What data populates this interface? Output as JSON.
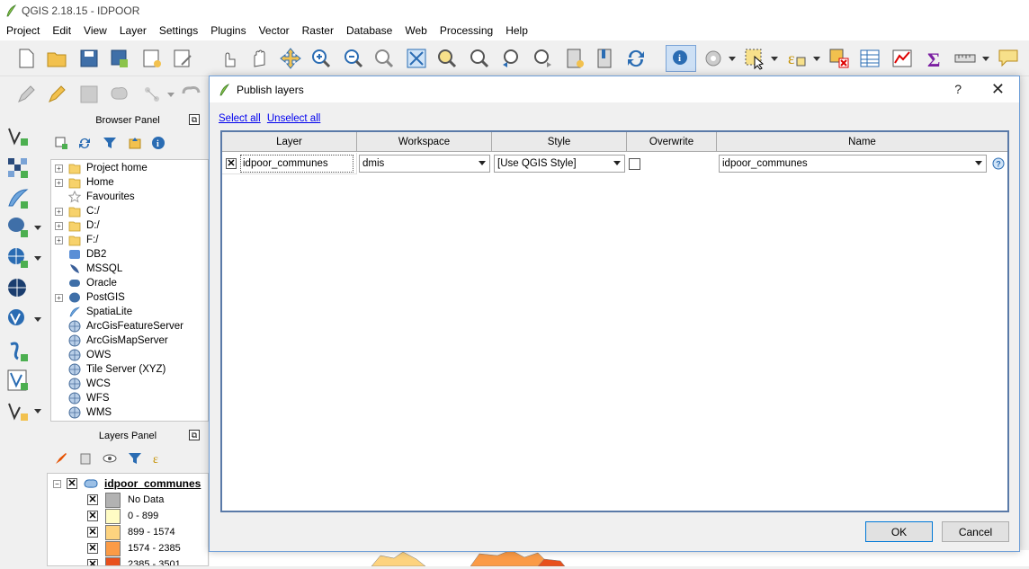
{
  "window": {
    "title": "QGIS 2.18.15 - IDPOOR"
  },
  "menu": [
    "Project",
    "Edit",
    "View",
    "Layer",
    "Settings",
    "Plugins",
    "Vector",
    "Raster",
    "Database",
    "Web",
    "Processing",
    "Help"
  ],
  "browser_panel": {
    "title": "Browser Panel",
    "items": [
      {
        "label": "Project home",
        "icon": "folder-icon",
        "expandable": true
      },
      {
        "label": "Home",
        "icon": "folder-icon",
        "expandable": true
      },
      {
        "label": "Favourites",
        "icon": "star-icon",
        "expandable": false
      },
      {
        "label": "C:/",
        "icon": "folder-icon",
        "expandable": true
      },
      {
        "label": "D:/",
        "icon": "folder-icon",
        "expandable": true
      },
      {
        "label": "F:/",
        "icon": "folder-icon",
        "expandable": true
      },
      {
        "label": "DB2",
        "icon": "db2-icon",
        "expandable": false
      },
      {
        "label": "MSSQL",
        "icon": "mssql-icon",
        "expandable": false
      },
      {
        "label": "Oracle",
        "icon": "oracle-icon",
        "expandable": false
      },
      {
        "label": "PostGIS",
        "icon": "postgis-icon",
        "expandable": true
      },
      {
        "label": "SpatiaLite",
        "icon": "spatialite-icon",
        "expandable": false
      },
      {
        "label": "ArcGisFeatureServer",
        "icon": "globe-icon",
        "expandable": false
      },
      {
        "label": "ArcGisMapServer",
        "icon": "globe-icon",
        "expandable": false
      },
      {
        "label": "OWS",
        "icon": "globe-icon",
        "expandable": false
      },
      {
        "label": "Tile Server (XYZ)",
        "icon": "globe-icon",
        "expandable": false
      },
      {
        "label": "WCS",
        "icon": "globe-icon",
        "expandable": false
      },
      {
        "label": "WFS",
        "icon": "globe-icon",
        "expandable": false
      },
      {
        "label": "WMS",
        "icon": "globe-icon",
        "expandable": false
      }
    ]
  },
  "layers_panel": {
    "title": "Layers Panel",
    "layer_name": "idpoor_communes",
    "legend": [
      {
        "label": "No Data",
        "color": "#b2b2b2"
      },
      {
        "label": "0 - 899",
        "color": "#fffcc4"
      },
      {
        "label": "899 - 1574",
        "color": "#fdd37f"
      },
      {
        "label": "1574 - 2385",
        "color": "#fb9b46"
      },
      {
        "label": "2385 - 3501",
        "color": "#e8501c"
      }
    ]
  },
  "dialog": {
    "title": "Publish layers",
    "help": "?",
    "select_all": "Select all",
    "unselect_all": "Unselect all",
    "columns": [
      "Layer",
      "Workspace",
      "Style",
      "Overwrite",
      "Name"
    ],
    "row": {
      "layer": "idpoor_communes",
      "workspace": "dmis",
      "style": "[Use QGIS Style]",
      "overwrite": false,
      "name": "idpoor_communes"
    },
    "ok": "OK",
    "cancel": "Cancel"
  },
  "colors": {
    "accent": "#0078d7",
    "dialog_border": "#6f9fd8"
  }
}
